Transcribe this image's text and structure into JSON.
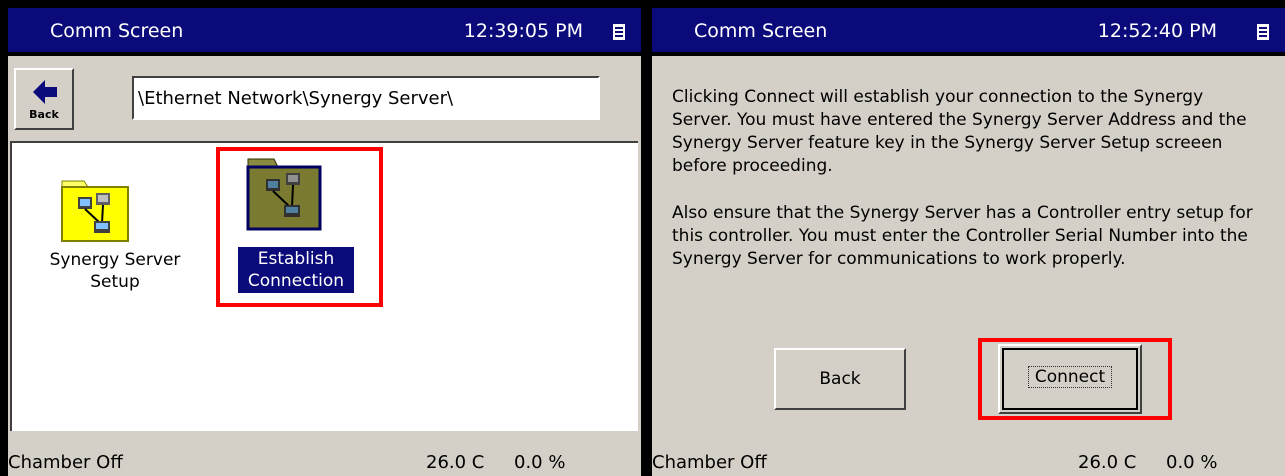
{
  "left_window": {
    "title": "Comm Screen",
    "clock": "12:39:05 PM",
    "back_button_label": "Back",
    "path": "\\Ethernet Network\\Synergy Server\\",
    "items": [
      {
        "label": "Synergy Server Setup",
        "icon": "network-folder-icon",
        "selected": false
      },
      {
        "label": "Establish Connection",
        "icon": "network-folder-icon",
        "selected": true
      }
    ],
    "status": {
      "chamber": "Chamber Off",
      "temperature": "26.0 C",
      "percent": "0.0 %"
    }
  },
  "right_window": {
    "title": "Comm Screen",
    "clock": "12:52:40 PM",
    "paragraph_1": "Clicking Connect will establish your connection to the Synergy Server.  You must have entered the Synergy Server Address and the Synergy Server feature key in the Synergy Server Setup screeen before proceeding.",
    "paragraph_2": "Also ensure that the Synergy Server has a Controller entry setup for this controller.  You must enter the Controller Serial Number into the Synergy Server for communications to work properly.",
    "back_button": "Back",
    "connect_button": "Connect",
    "status": {
      "chamber": "Chamber Off",
      "temperature": "26.0 C",
      "percent": "0.0 %"
    }
  },
  "colors": {
    "titlebar": "#0a0a7a",
    "highlight": "#ff0000",
    "panel": "#d4d0c8"
  }
}
